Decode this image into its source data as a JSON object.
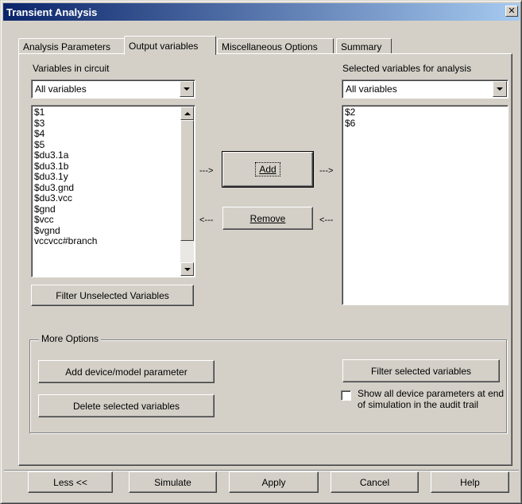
{
  "window": {
    "title": "Transient Analysis",
    "close_glyph": "✕"
  },
  "tabs": [
    {
      "label": "Analysis Parameters",
      "active": false
    },
    {
      "label": "Output variables",
      "active": true
    },
    {
      "label": "Miscellaneous Options",
      "active": false
    },
    {
      "label": "Summary",
      "active": false
    }
  ],
  "left": {
    "heading": "Variables in circuit",
    "filter_value": "All variables",
    "items": [
      "$1",
      "$3",
      "$4",
      "$5",
      "$du3.1a",
      "$du3.1b",
      "$du3.1y",
      "$du3.gnd",
      "$du3.vcc",
      "$gnd",
      "$vcc",
      "$vgnd",
      "vccvcc#branch"
    ],
    "filter_button": "Filter Unselected Variables"
  },
  "right": {
    "heading": "Selected variables for analysis",
    "filter_value": "All variables",
    "items": [
      "$2",
      "$6"
    ]
  },
  "transfer": {
    "add_label": "Add",
    "add_arrow_left": "--->",
    "add_arrow_right": "--->",
    "remove_label": "Remove",
    "remove_arrow_left": "<---",
    "remove_arrow_right": "<---"
  },
  "more_options": {
    "legend": "More Options",
    "add_param_button": "Add device/model parameter",
    "delete_button": "Delete selected variables",
    "filter_selected_button": "Filter selected variables",
    "show_all_checkbox_label": "Show all device parameters at end of simulation in the audit trail",
    "show_all_checked": false
  },
  "footer": {
    "less_button": "Less <<",
    "simulate_button": "Simulate",
    "apply_button": "Apply",
    "cancel_button": "Cancel",
    "help_button": "Help"
  },
  "colors": {
    "title_start": "#0a246a",
    "title_end": "#a6caf0",
    "face": "#d4d0c8"
  },
  "icons": {
    "dropdown": "triangle-down",
    "scroll_up": "triangle-up",
    "scroll_down": "triangle-down",
    "close": "x-mark"
  }
}
